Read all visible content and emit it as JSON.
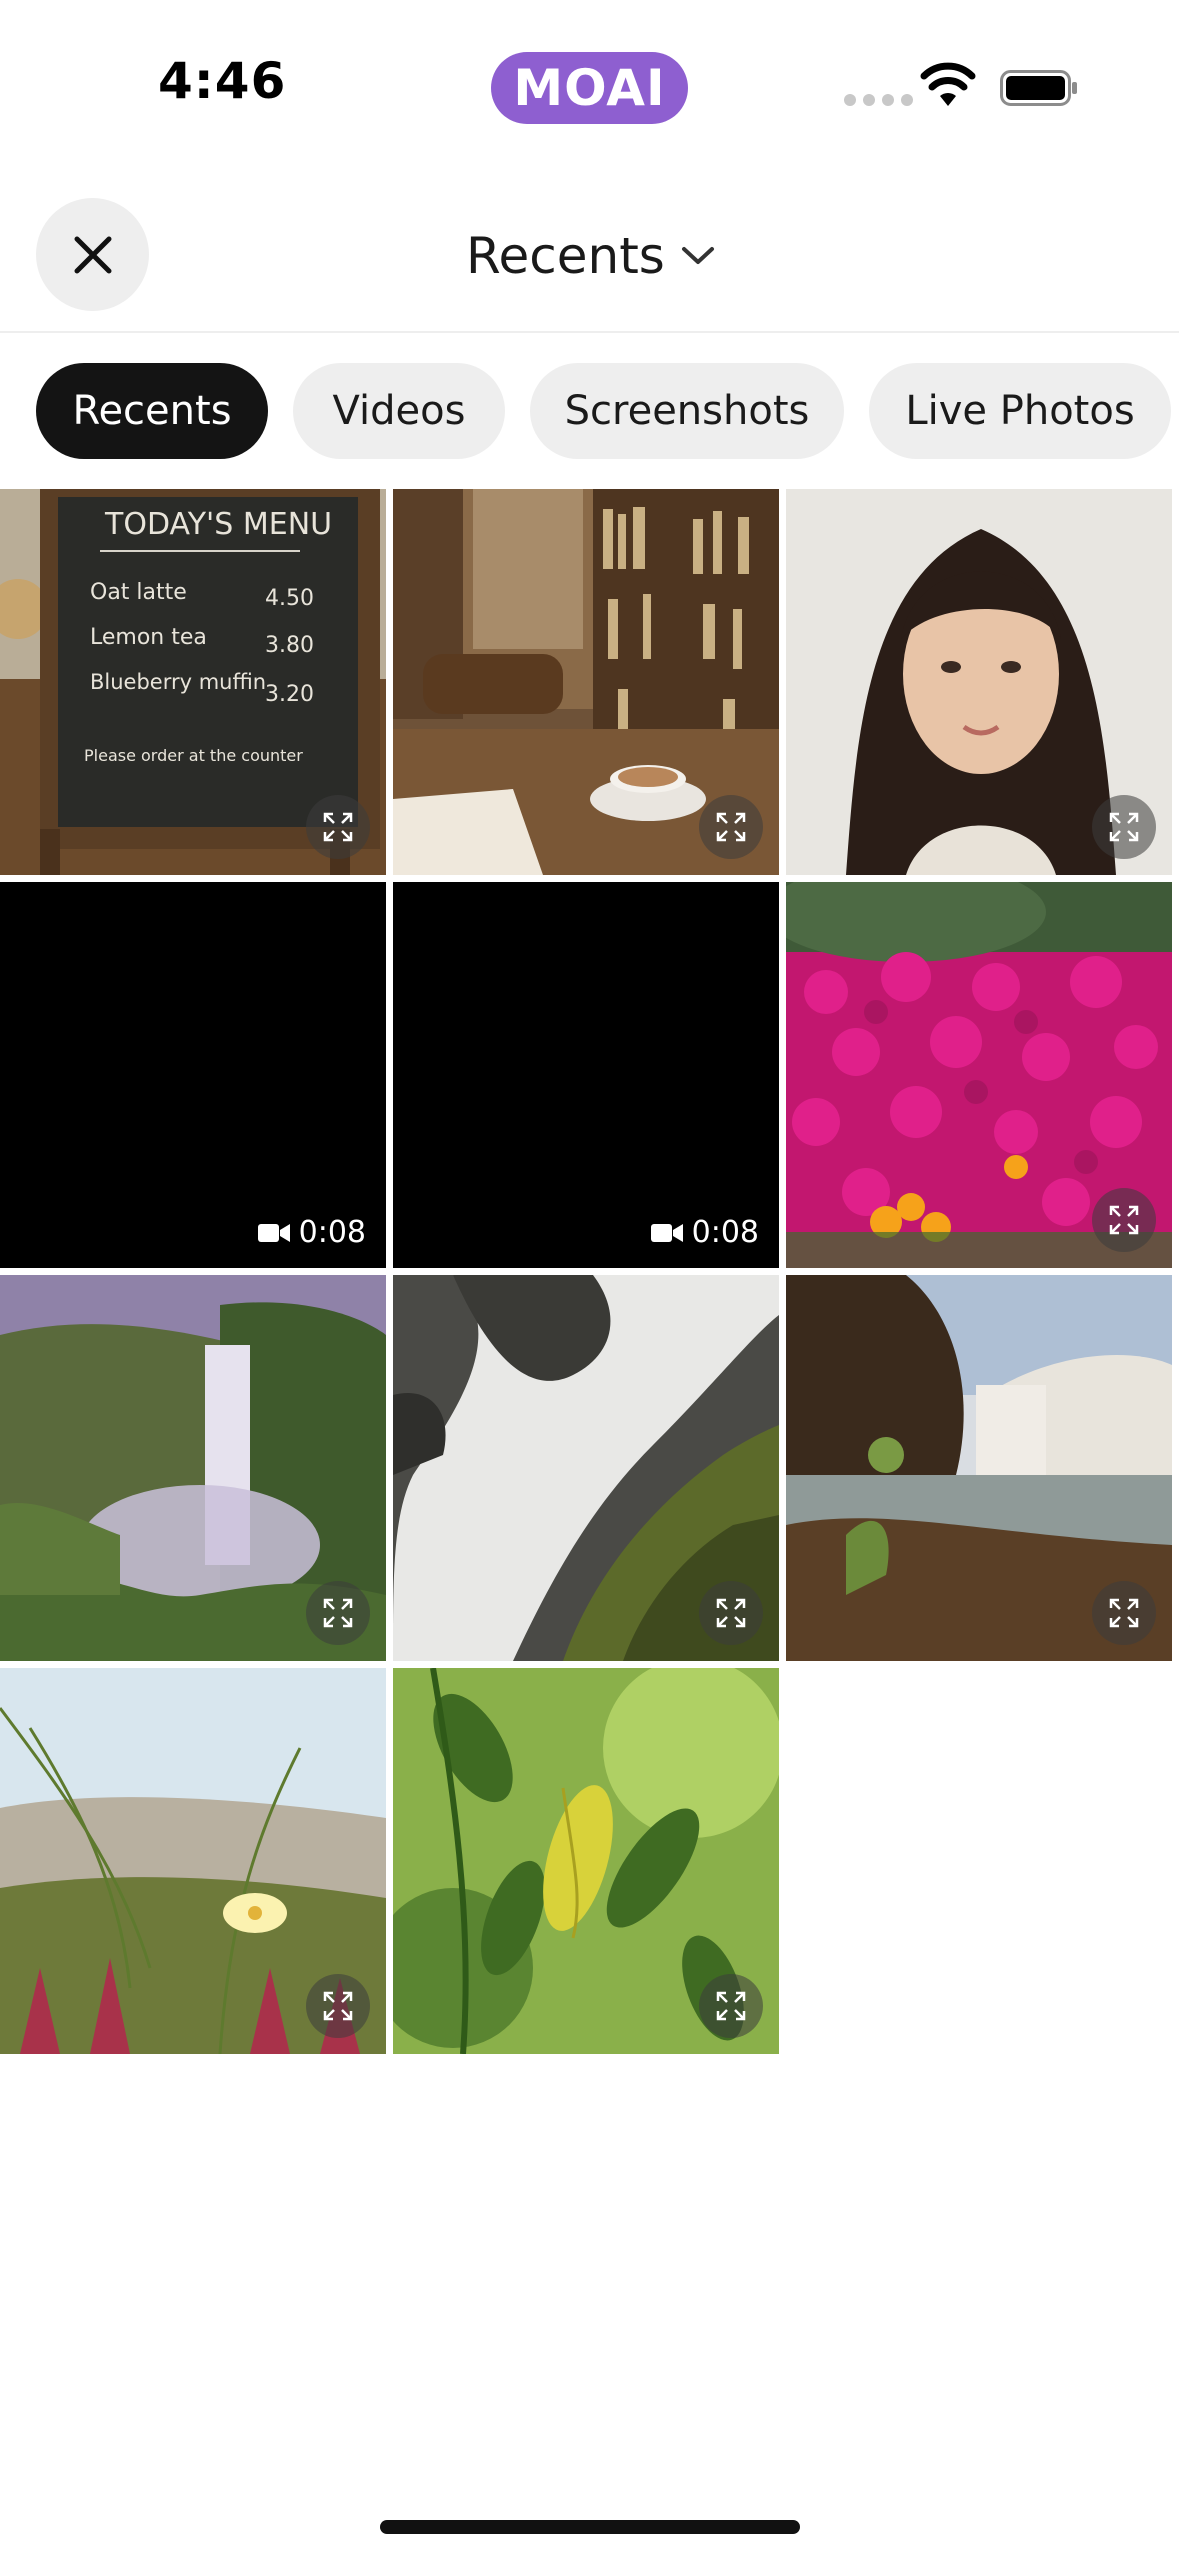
{
  "status_bar": {
    "time": "4:46",
    "brand": "MOAI",
    "brand_color": "#8e5fd0"
  },
  "header": {
    "close_icon": "close-icon",
    "title": "Recents",
    "title_icon": "chevron-down-icon"
  },
  "filters": [
    {
      "label": "Recents",
      "active": true
    },
    {
      "label": "Videos",
      "active": false
    },
    {
      "label": "Screenshots",
      "active": false
    },
    {
      "label": "Live Photos",
      "active": false
    }
  ],
  "grid": {
    "items": [
      {
        "kind": "photo",
        "subject": "chalkboard menu",
        "menu": {
          "title": "TODAY'S MENU",
          "lines": [
            [
              "Oat latte",
              "4.50"
            ],
            [
              "Lemon tea",
              "3.80"
            ],
            [
              "Blueberry muffin",
              "3.20"
            ]
          ],
          "footer": "Please order at the counter"
        }
      },
      {
        "kind": "photo",
        "subject": "coffee in bookstore cafe"
      },
      {
        "kind": "photo",
        "subject": "portrait"
      },
      {
        "kind": "video",
        "duration": "0:08"
      },
      {
        "kind": "video",
        "duration": "0:08"
      },
      {
        "kind": "photo",
        "subject": "magenta flowers"
      },
      {
        "kind": "photo",
        "subject": "waterfall in misty valley"
      },
      {
        "kind": "photo",
        "subject": "long exposure waterfall"
      },
      {
        "kind": "photo",
        "subject": "waterfall by the lake"
      },
      {
        "kind": "photo",
        "subject": "dune grass flower"
      },
      {
        "kind": "photo",
        "subject": "green leaves"
      }
    ]
  },
  "colors": {
    "chip_active_bg": "#141414",
    "chip_bg": "#eeeeee",
    "video_bg": "#000000"
  }
}
